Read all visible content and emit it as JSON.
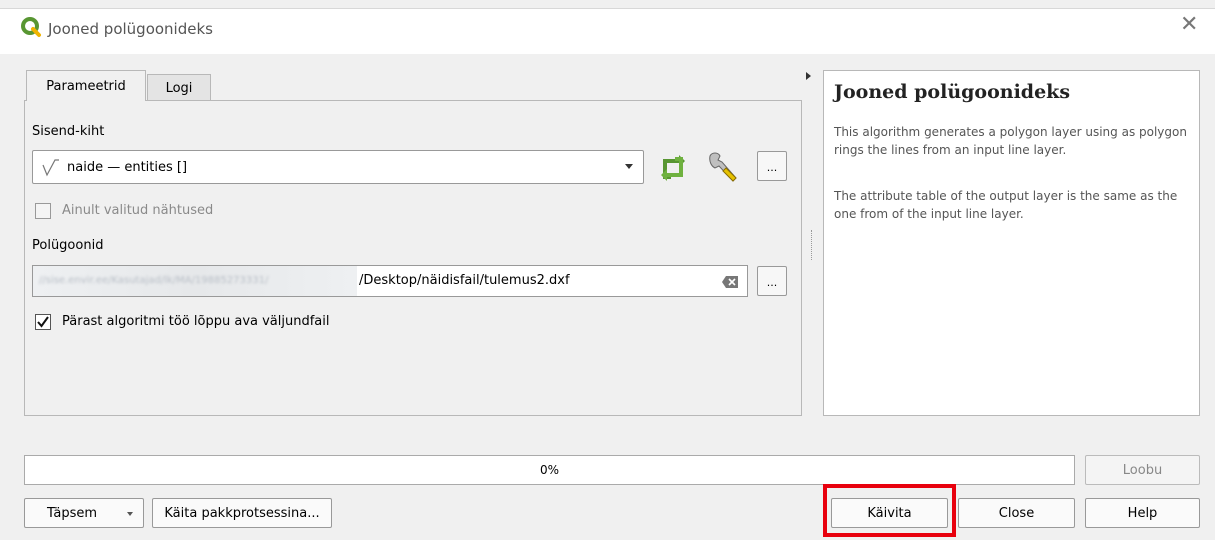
{
  "window": {
    "title": "Jooned polügoonideks",
    "close_glyph": "✕"
  },
  "tabs": [
    {
      "label": "Parameetrid",
      "active": true
    },
    {
      "label": "Logi",
      "active": false
    }
  ],
  "params": {
    "input_layer_label": "Sisend-kiht",
    "input_layer_value": "naide — entities []",
    "selected_only_label": "Ainult valitud nähtused",
    "output_label": "Polügoonid",
    "output_blurred": "//sise.envir.ee/Kasutajad/lk/MA/19885273331/",
    "output_value": "/Desktop/näidisfail/tulemus2.dxf",
    "open_after_label": "Pärast algoritmi töö lõppu ava väljundfail",
    "open_after_checked": true,
    "browse_label": "..."
  },
  "help": {
    "title": "Jooned polügoonideks",
    "p1": "This algorithm generates a polygon layer using as polygon rings the lines from an input line layer.",
    "p2": "The attribute table of the output layer is the same as the one from of the input line layer."
  },
  "progress": {
    "value": 0,
    "label": "0%"
  },
  "buttons": {
    "cancel": "Loobu",
    "advanced": "Täpsem",
    "batch": "Käita pakkprotsessina...",
    "run": "Käivita",
    "close": "Close",
    "help": "Help"
  },
  "colors": {
    "accent_green": "#589632",
    "highlight_red": "#e8000d"
  },
  "icons": [
    "qgis-logo-icon",
    "line-layer-icon",
    "iterate-icon",
    "wrench-icon",
    "clear-icon",
    "dropdown-arrow-icon",
    "collapse-arrow-icon",
    "checkmark-icon"
  ]
}
